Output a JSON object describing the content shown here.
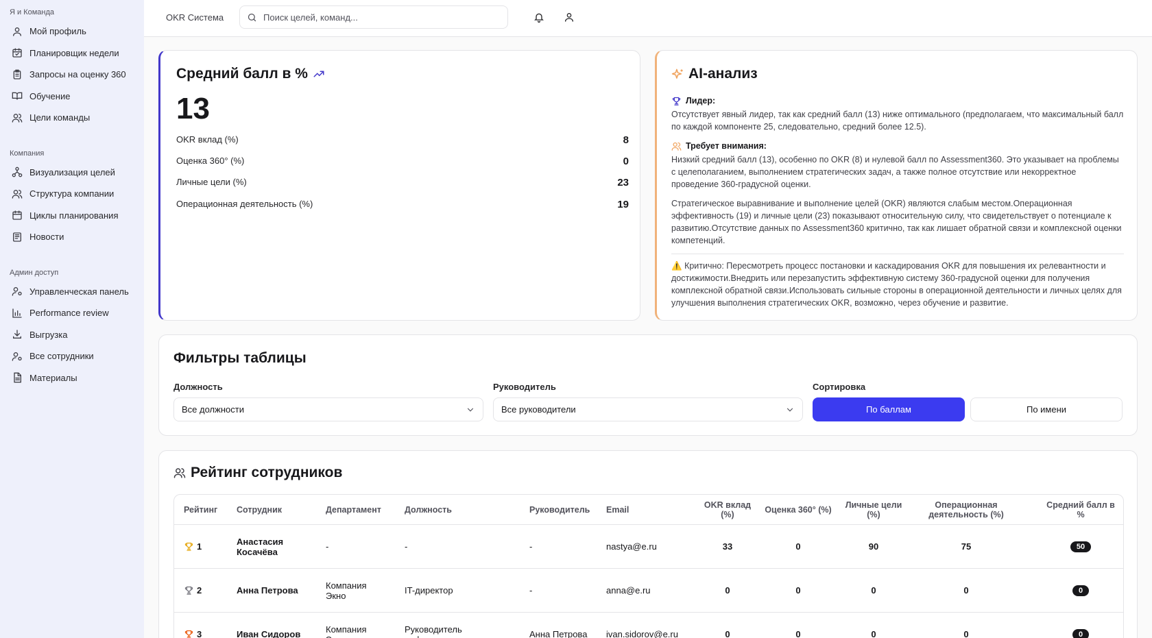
{
  "sidebar": {
    "groups": [
      {
        "label": "Я и Команда",
        "items": [
          {
            "label": "Мой профиль",
            "icon": "user-icon"
          },
          {
            "label": "Планировщик недели",
            "icon": "calendar-check-icon"
          },
          {
            "label": "Запросы на оценку 360",
            "icon": "clipboard-list-icon"
          },
          {
            "label": "Обучение",
            "icon": "book-open-icon"
          },
          {
            "label": "Цели команды",
            "icon": "users-icon"
          }
        ]
      },
      {
        "label": "Компания",
        "items": [
          {
            "label": "Визуализация целей",
            "icon": "network-icon"
          },
          {
            "label": "Структура компании",
            "icon": "users-icon"
          },
          {
            "label": "Циклы планирования",
            "icon": "calendar-icon"
          },
          {
            "label": "Новости",
            "icon": "newspaper-icon"
          }
        ]
      },
      {
        "label": "Админ доступ",
        "items": [
          {
            "label": "Управленческая панель",
            "icon": "user-cog-icon"
          },
          {
            "label": "Performance review",
            "icon": "bar-chart-icon"
          },
          {
            "label": "Выгрузка",
            "icon": "download-icon"
          },
          {
            "label": "Все сотрудники",
            "icon": "user-cog-icon"
          },
          {
            "label": "Материалы",
            "icon": "file-text-icon"
          }
        ]
      }
    ]
  },
  "header": {
    "app_title": "OKR Система",
    "search_placeholder": "Поиск целей, команд..."
  },
  "avg_card": {
    "title": "Средний балл в %",
    "value": "13",
    "metrics": [
      {
        "label": "OKR вклад (%)",
        "value": "8"
      },
      {
        "label": "Оценка 360° (%)",
        "value": "0"
      },
      {
        "label": "Личные цели (%)",
        "value": "23"
      },
      {
        "label": "Операционная деятельность (%)",
        "value": "19"
      }
    ]
  },
  "ai_card": {
    "title": "AI-анализ",
    "leader_heading": "Лидер:",
    "leader_text": "Отсутствует явный лидер, так как средний балл (13) ниже оптимального (предполагаем, что максимальный балл по каждой компоненте 25, следовательно, средний более 12.5).",
    "attention_heading": "Требует внимания:",
    "attention_text": "Низкий средний балл (13), особенно по OKR (8) и нулевой балл по Assessment360. Это указывает на проблемы с целеполаганием, выполнением стратегических задач, а также полное отсутствие или некорректное проведение 360-градусной оценки.",
    "strategy_text": "Стратегическое выравнивание и выполнение целей (OKR) являются слабым местом.Операционная эффективность (19) и личные цели (23) показывают относительную силу, что свидетельствует о потенциале к развитию.Отсутствие данных по Assessment360 критично, так как лишает обратной связи и комплексной оценки компетенций.",
    "critical_icon": "⚠️",
    "critical_text": "Критично: Пересмотреть процесс постановки и каскадирования OKR для повышения их релевантности и достижимости.Внедрить или перезапустить эффективную систему 360-градусной оценки для получения комплексной обратной связи.Использовать сильные стороны в операционной деятельности и личных целях для улучшения выполнения стратегических OKR, возможно, через обучение и развитие."
  },
  "filters": {
    "title": "Фильтры таблицы",
    "position_label": "Должность",
    "position_value": "Все должности",
    "manager_label": "Руководитель",
    "manager_value": "Все руководители",
    "sort_label": "Сортировка",
    "sort_by_score": "По баллам",
    "sort_by_name": "По имени"
  },
  "ranking": {
    "title": "Рейтинг сотрудников",
    "columns": {
      "rank": "Рейтинг",
      "employee": "Сотрудник",
      "department": "Департамент",
      "position": "Должность",
      "manager": "Руководитель",
      "email": "Email",
      "okr": "OKR вклад (%)",
      "a360": "Оценка 360° (%)",
      "personal": "Личные цели (%)",
      "ops": "Операционная деятельность (%)",
      "avg": "Средний балл в %"
    },
    "rows": [
      {
        "rank": "1",
        "employee": "Анастасия Косачёва",
        "department": "-",
        "position": "-",
        "manager": "-",
        "email": "nastya@e.ru",
        "okr": "33",
        "a360": "0",
        "personal": "90",
        "ops": "75",
        "avg": "50"
      },
      {
        "rank": "2",
        "employee": "Анна Петрова",
        "department": "Компания Экно",
        "position": "IT-директор",
        "manager": "-",
        "email": "anna@e.ru",
        "okr": "0",
        "a360": "0",
        "personal": "0",
        "ops": "0",
        "avg": "0"
      },
      {
        "rank": "3",
        "employee": "Иван Сидоров",
        "department": "Компания Экно",
        "position": "Руководитель инфраструктуры",
        "manager": "Анна Петрова",
        "email": "ivan.sidorov@e.ru",
        "okr": "0",
        "a360": "0",
        "personal": "0",
        "ops": "0",
        "avg": "0"
      }
    ]
  },
  "colors": {
    "accent": "#3b3bf0",
    "sidebar_bg": "#eef0fb",
    "gold": "#e5a50a",
    "silver": "#71717a",
    "bronze": "#ea580c",
    "ai_border": "#f0b27a"
  }
}
